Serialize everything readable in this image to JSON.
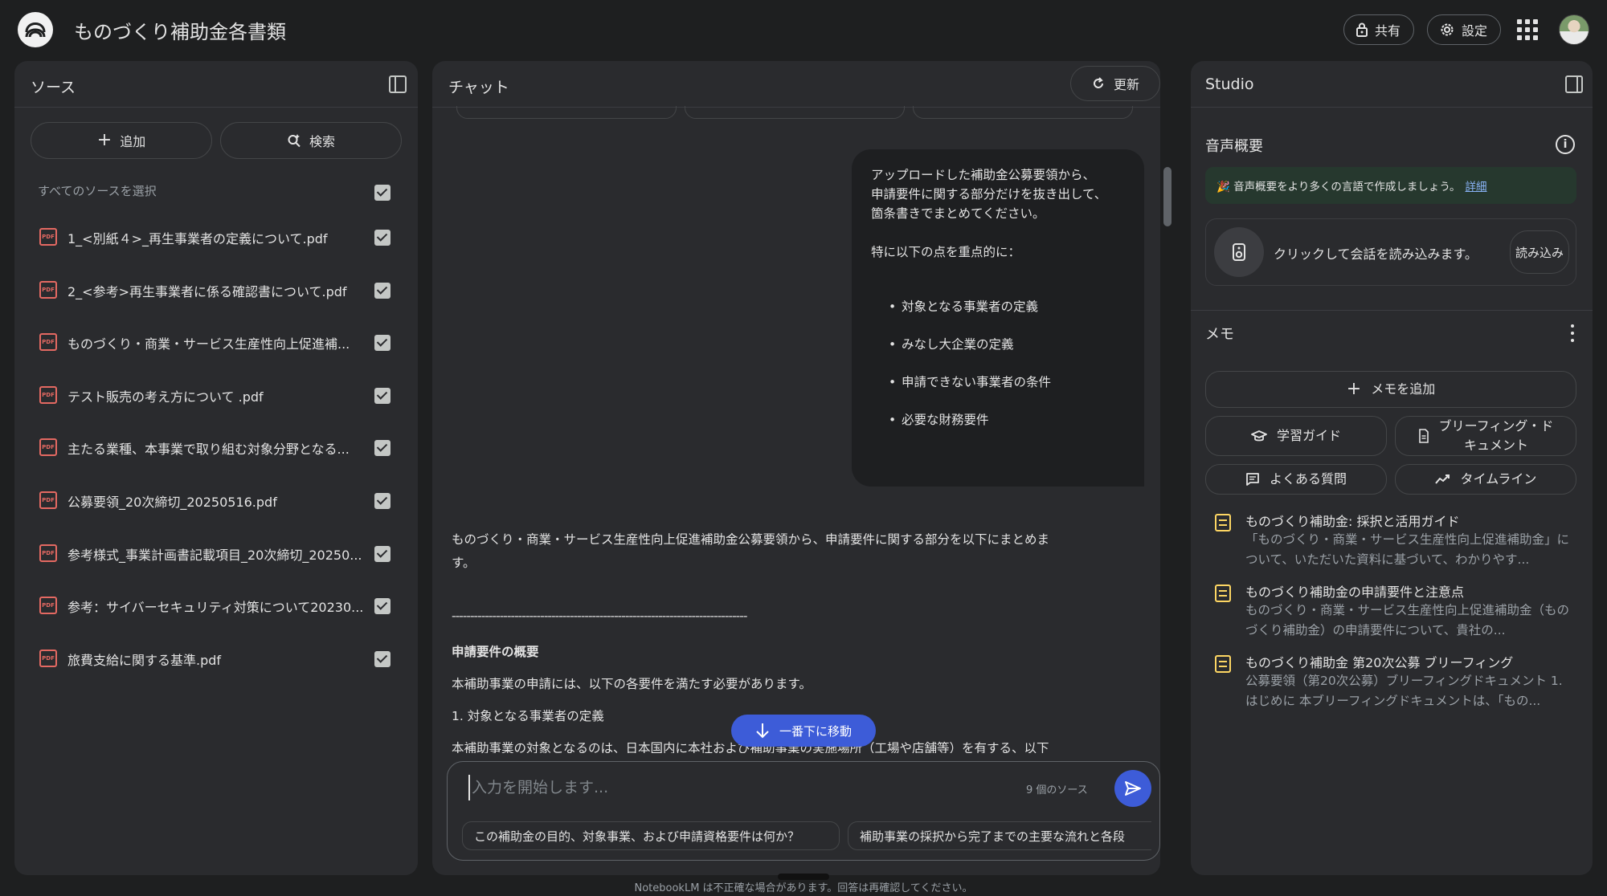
{
  "header": {
    "title": "ものづくり補助金各書類",
    "share_label": "共有",
    "settings_label": "設定"
  },
  "sources": {
    "title": "ソース",
    "add_label": "追加",
    "search_label": "検索",
    "select_all_label": "すべてのソースを選択",
    "items": [
      {
        "name": "1_<別紙４>_再生事業者の定義について.pdf"
      },
      {
        "name": "2_<参考>再生事業者に係る確認書について.pdf"
      },
      {
        "name": "ものづくり・商業・サービス生産性向上促進補..."
      },
      {
        "name": "テスト販売の考え方について .pdf"
      },
      {
        "name": "主たる業種、本事業で取り組む対象分野となる..."
      },
      {
        "name": "公募要領_20次締切_20250516.pdf"
      },
      {
        "name": "参考様式_事業計画書記載項目_20次締切_20250..."
      },
      {
        "name": "参考：サイバーセキュリティ対策について20230..."
      },
      {
        "name": "旅費支給に関する基準.pdf"
      }
    ]
  },
  "chat": {
    "title": "チャット",
    "refresh_label": "更新",
    "user_message": "アップロードした補助金公募要領から、\n申請要件に関する部分だけを抜き出して、\n箇条書きでまとめてください。\n\n特に以下の点を重点的に：",
    "user_bullets": [
      "対象となる事業者の定義",
      "みなし大企業の定義",
      "申請できない事業者の条件",
      "必要な財務要件"
    ],
    "response_lines": {
      "intro_1": "ものづくり・商業・サービス生産性向上促進補助金公募要領から、申請要件に関する部分を以下にまとめま",
      "intro_2": "す。",
      "separator": "--------------------------------------------------------------------------------",
      "heading": "申請要件の概要",
      "line_1": "本補助事業の申請には、以下の各要件を満たす必要があります。",
      "line_2": "1. 対象となる事業者の定義",
      "line_3": "本補助事業の対象となるのは、日本国内に本社および補助事業の実施場所（工場や店舗等）を有する、以下"
    },
    "jump_label": "一番下に移動",
    "input_placeholder": "入力を開始します...",
    "source_count": "9 個のソース",
    "suggestions": [
      "この補助金の目的、対象事業、および申請資格要件は何か？",
      "補助事業の採択から完了までの主要な流れと各段"
    ],
    "disclaimer": "NotebookLM は不正確な場合があります。回答は再確認してください。"
  },
  "studio": {
    "title": "Studio",
    "audio_overview_label": "音声概要",
    "banner_text": "🎉 音声概要をより多くの言語で作成しましょう。",
    "banner_link": "詳細",
    "audio_card_text": "クリックして会話を読み込みます。",
    "load_label": "読み込み",
    "memo_label": "メモ",
    "add_memo_label": "メモを追加",
    "study_guide_label": "学習ガイド",
    "briefing_label": "ブリーフィング・ド\nキュメント",
    "faq_label": "よくある質問",
    "timeline_label": "タイムライン",
    "notes": [
      {
        "title": "ものづくり補助金: 採択と活用ガイド",
        "body": "「ものづくり・商業・サービス生産性向上促進補助金」について、いただいた資料に基づいて、わかりやす..."
      },
      {
        "title": "ものづくり補助金の申請要件と注意点",
        "body": "ものづくり・商業・サービス生産性向上促進補助金（ものづくり補助金）の申請要件について、貴社の..."
      },
      {
        "title": "ものづくり補助金 第20次公募 ブリーフィング",
        "body": "公募要領（第20次公募）ブリーフィングドキュメント 1. はじめに 本ブリーフィングドキュメントは、「もの..."
      }
    ]
  },
  "colors": {
    "background": "#1e1f20",
    "panel": "#2a2b2e",
    "accent_blue": "#3d5cd8",
    "pdf_red": "#e46962",
    "note_yellow": "#fdd663",
    "banner_green": "#26382e"
  }
}
